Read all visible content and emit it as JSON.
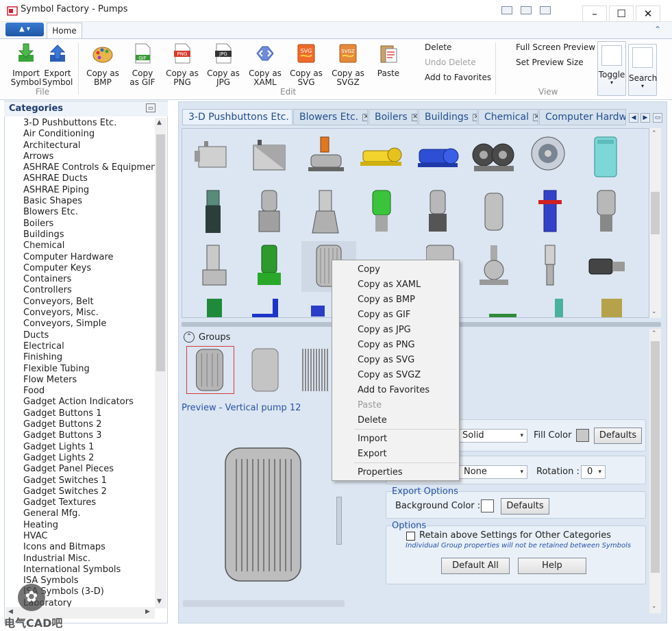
{
  "window": {
    "title": "Symbol Factory - Pumps",
    "minimize": "–",
    "maximize": "☐",
    "close": "✕"
  },
  "ribbon": {
    "tab_home": "Home",
    "file": {
      "label": "File",
      "import": "Import\nSymbol",
      "export": "Export\nSymbol"
    },
    "edit": {
      "label": "Edit",
      "copy_bmp": "Copy as\nBMP",
      "copy_gif": "Copy\nas GIF",
      "copy_png": "Copy as\nPNG",
      "copy_jpg": "Copy as\nJPG",
      "copy_xaml": "Copy as\nXAML",
      "copy_svg": "Copy as\nSVG",
      "copy_svgz": "Copy as\nSVGZ",
      "paste": "Paste",
      "delete": "Delete",
      "undo_delete": "Undo Delete",
      "add_favorites": "Add to Favorites"
    },
    "view": {
      "label": "View",
      "full_screen": "Full Screen Preview",
      "set_preview_size": "Set Preview Size",
      "toggle": "Toggle",
      "search": "Search"
    }
  },
  "categories": {
    "title": "Categories",
    "items": [
      "3-D Pushbuttons Etc.",
      "Air Conditioning",
      "Architectural",
      "Arrows",
      "ASHRAE Controls & Equipment",
      "ASHRAE Ducts",
      "ASHRAE Piping",
      "Basic Shapes",
      "Blowers Etc.",
      "Boilers",
      "Buildings",
      "Chemical",
      "Computer Hardware",
      "Computer Keys",
      "Containers",
      "Controllers",
      "Conveyors, Belt",
      "Conveyors, Misc.",
      "Conveyors, Simple",
      "Ducts",
      "Electrical",
      "Finishing",
      "Flexible Tubing",
      "Flow Meters",
      "Food",
      "Gadget Action Indicators",
      "Gadget Buttons 1",
      "Gadget Buttons 2",
      "Gadget Buttons 3",
      "Gadget Lights 1",
      "Gadget Lights 2",
      "Gadget Panel Pieces",
      "Gadget Switches 1",
      "Gadget Switches 2",
      "Gadget Textures",
      "General Mfg.",
      "Heating",
      "HVAC",
      "Icons and Bitmaps",
      "Industrial Misc.",
      "International Symbols",
      "ISA Symbols",
      "ISA Symbols (3-D)",
      "Laboratory"
    ]
  },
  "doc_tabs": [
    "3-D Pushbuttons Etc.",
    "Blowers Etc.",
    "Boilers",
    "Buildings",
    "Chemical",
    "Computer Hardware"
  ],
  "groups": {
    "label": "Groups"
  },
  "preview": {
    "label": "Preview - Vertical pump 12"
  },
  "properties": {
    "line_style": "Solid",
    "fill_color_label": "Fill Color",
    "defaults": "Defaults",
    "flip": "None",
    "rotation_label": "Rotation :",
    "rotation": "0",
    "export_options_title": "Export Options",
    "background_color_label": "Background Color :",
    "export_defaults": "Defaults",
    "options_title": "Options",
    "retain_label": "Retain above Settings for Other Categories",
    "retain_note": "Individual Group properties will not be retained between Symbols",
    "default_all": "Default All",
    "help": "Help"
  },
  "context_menu": {
    "copy": "Copy",
    "copy_xaml": "Copy as XAML",
    "copy_bmp": "Copy as BMP",
    "copy_gif": "Copy as GIF",
    "copy_jpg": "Copy as JPG",
    "copy_png": "Copy as PNG",
    "copy_svg": "Copy as SVG",
    "copy_svgz": "Copy as SVGZ",
    "add_favorites": "Add to Favorites",
    "paste": "Paste",
    "delete": "Delete",
    "import": "Import",
    "export": "Export",
    "properties": "Properties"
  },
  "watermark": "电气CAD吧",
  "colors": {
    "accent": "#2751a8",
    "panel": "#dce6f2",
    "tab_text": "#1f4d8c",
    "selection": "#d23a3a"
  }
}
